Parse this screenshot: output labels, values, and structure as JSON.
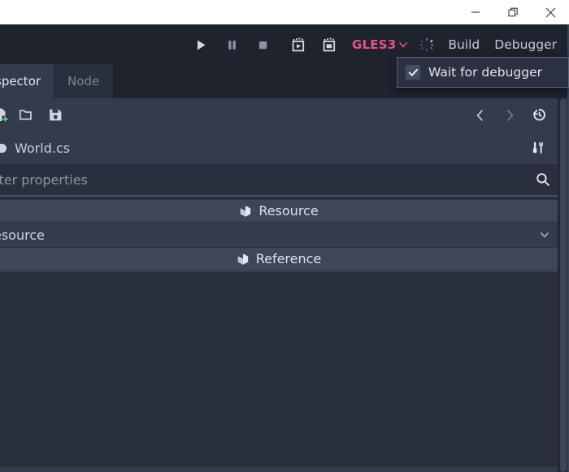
{
  "window": {
    "controls": [
      {
        "name": "minimize",
        "label": "Minimize",
        "glyph": "minimize-icon"
      },
      {
        "name": "restore",
        "label": "Restore",
        "glyph": "restore-icon"
      },
      {
        "name": "close",
        "label": "Close",
        "glyph": "close-icon"
      }
    ]
  },
  "toolbar": {
    "play_label": "Play",
    "pause_label": "Pause Scene",
    "stop_label": "Stop",
    "play_scene_label": "Play Scene",
    "play_custom_label": "Play Custom Scene",
    "renderer": "GLES3",
    "renderer_color": "#e0558a",
    "build_label": "Build",
    "debugger_label": "Debugger"
  },
  "popup": {
    "visible": true,
    "items": [
      {
        "label": "Wait for debugger",
        "checked": true
      }
    ]
  },
  "tabs": [
    {
      "label": "spector",
      "full_label": "Inspector",
      "active": true
    },
    {
      "label": "Node",
      "full_label": "Node",
      "active": false
    }
  ],
  "inspector": {
    "toolbar_icons": [
      "new-resource-icon",
      "open-resource-icon",
      "save-resource-icon",
      "history-prev-icon",
      "history-next-icon",
      "history-icon"
    ],
    "resource_name": "World.cs",
    "resource_icon": "script-icon",
    "tools_icon": "tools-icon",
    "filter_placeholder": "lter properties",
    "filter_placeholder_full": "Filter properties",
    "search_icon": "search-icon",
    "sections": [
      {
        "type": "header",
        "label": "Resource",
        "icon": "cube-icon"
      },
      {
        "type": "row",
        "label": "esource",
        "full_label": "Resource",
        "icon": "chevron-down-icon"
      },
      {
        "type": "header",
        "label": "Reference",
        "icon": "cube-icon"
      }
    ]
  },
  "colors": {
    "titlebar_bg": "#ffffff",
    "toolbar_bg": "#1f232e",
    "panel_bg": "#343b4c",
    "list_bg": "#2a2f3d",
    "section_bg": "#3e4659",
    "accent_pink": "#e0558a",
    "accent_green": "#5ad18f",
    "text_primary": "#dfe3ec",
    "text_muted": "#7b8295"
  }
}
